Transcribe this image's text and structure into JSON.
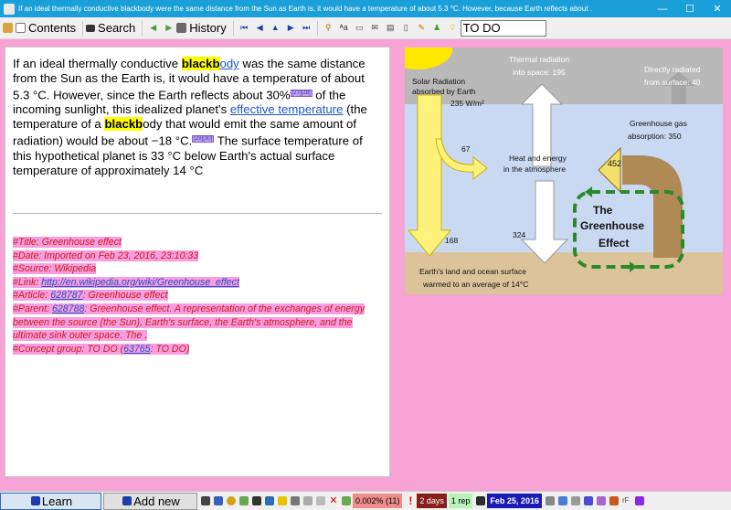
{
  "window": {
    "title": "If an ideal thermally conductive blackbody were the same distance from the Sun as Earth is, it would have a temperature of about 5.3 °C. However, because Earth reflects about .",
    "minimize": "—",
    "maximize": "☐",
    "close": "✕"
  },
  "toolbar": {
    "contents_label": "Contents",
    "search_label": "Search",
    "history_label": "History",
    "todo_value": "TO DO"
  },
  "article": {
    "p1": "If an ideal thermally conductive ",
    "hl1": "blackb",
    "link1": "ody",
    "p2": " was the same distance from the Sun as the Earth is, it would have a temperature of about 5.3 °C. However, since the Earth reflects about 30%",
    "ref1": "[27][28]",
    "p3": " of the incoming sunlight, this idealized planet's ",
    "link2": "effective temperature",
    "p4": " (the temperature of a ",
    "hl2": "blackb",
    "p5": "ody that would emit the same amount of radiation) would be about −18 °C.",
    "ref2": "[29][30]",
    "p6": " The surface temperature of this hypothetical planet is 33 °C below Earth's actual surface temperature of approximately 14 °C"
  },
  "meta": {
    "title": "#Title: Greenhouse effect",
    "date": "#Date: Imported on Feb 23, 2016, 23:10:33",
    "source": "#Source: Wikipedia",
    "link_prefix": "#Link: ",
    "link_url": "http://en.wikipedia.org/wiki/Greenhouse_effect",
    "article_prefix": "#Article: ",
    "article_id": "628787",
    "article_suffix": ": Greenhouse effect",
    "parent_prefix": "#Parent: ",
    "parent_id": "628788",
    "parent_suffix": ": Greenhouse effect. A representation of the exchanges of energy between the source (the Sun), Earth's surface, the Earth's atmosphere, and the ultimate sink outer space. The .",
    "concept_prefix": "#Concept group: TO DO (",
    "concept_id": "63765",
    "concept_suffix": ": TO DO)"
  },
  "diagram": {
    "solar_1": "Solar Radiation",
    "solar_2": "absorbed by Earth",
    "solar_3": "235 W/m²",
    "thermal_1": "Thermal radiation",
    "thermal_2": "into space: 195",
    "direct_1": "Directly radiated",
    "direct_2": "from surface: 40",
    "gh_abs_1": "Greenhouse gas",
    "gh_abs_2": "absorption: 350",
    "n67": "67",
    "heat_1": "Heat and energy",
    "heat_2": "in the atmosphere",
    "n452": "452",
    "box_1": "The",
    "box_2": "Greenhouse",
    "box_3": "Effect",
    "n168": "168",
    "n324": "324",
    "surface_1": "Earth's land and ocean surface",
    "surface_2": "warmed to an average of 14°C"
  },
  "bottombar": {
    "learn_label": "Learn",
    "addnew_label": "Add new",
    "stat_percent": "0.002% (11)",
    "stat_days": "2 days",
    "stat_rep": "1 rep",
    "stat_date": "Feb 25, 2016"
  },
  "colors": {
    "titlebar": "#1a9fd8",
    "background": "#f7a3d6",
    "meta_text": "#d01c1c",
    "highlight": "#ffff00"
  }
}
